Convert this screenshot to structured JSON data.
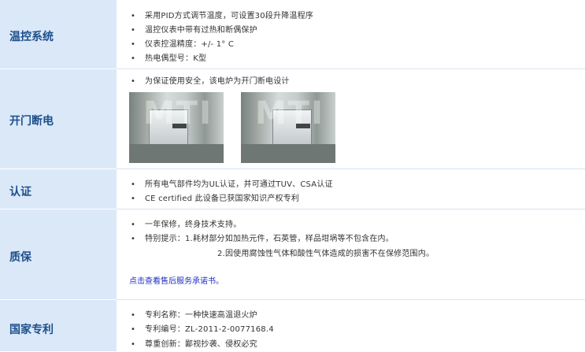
{
  "rows": [
    {
      "label": "温控系统",
      "bullet": "•",
      "items": [
        "采用PID方式调节温度，可设置30段升降温程序",
        "温控仪表中带有过热和断偶保护",
        "仪表控温精度：+/- 1° C",
        "热电偶型号：K型"
      ]
    },
    {
      "label": "开门断电",
      "bullet": "•",
      "items": [
        "为保证使用安全，该电炉为开门断电设计"
      ],
      "photos": [
        {
          "watermark": "MTI",
          "description": "furnace door open"
        },
        {
          "watermark": "MTI",
          "description": "furnace door closed"
        }
      ]
    },
    {
      "label": "认证",
      "bullet": "•",
      "items": [
        "所有电气部件均为UL认证，并可通过TUV、CSA认证",
        "CE certified 此设备已获国家知识产权专利"
      ]
    },
    {
      "label": "质保",
      "bullet": "•",
      "items": [
        "一年保修，终身技术支持。",
        "特别提示：1.耗材部分如加热元件，石英管，样品坩埚等不包含在内。"
      ],
      "continuation": "2.因使用腐蚀性气体和酸性气体造成的损害不在保修范围内。",
      "link": "点击查看售后服务承诺书。"
    },
    {
      "label": "国家专利",
      "bullet": "•",
      "items": [
        "专利名称：一种快速高温退火炉",
        "专利编号：ZL-2011-2-0077168.4",
        "尊重创新：鄙视抄袭、侵权必究"
      ]
    }
  ],
  "colors": {
    "label_bg": "#dbe8f8",
    "label_text": "#1d4f8c",
    "link": "#1f2fbf"
  }
}
